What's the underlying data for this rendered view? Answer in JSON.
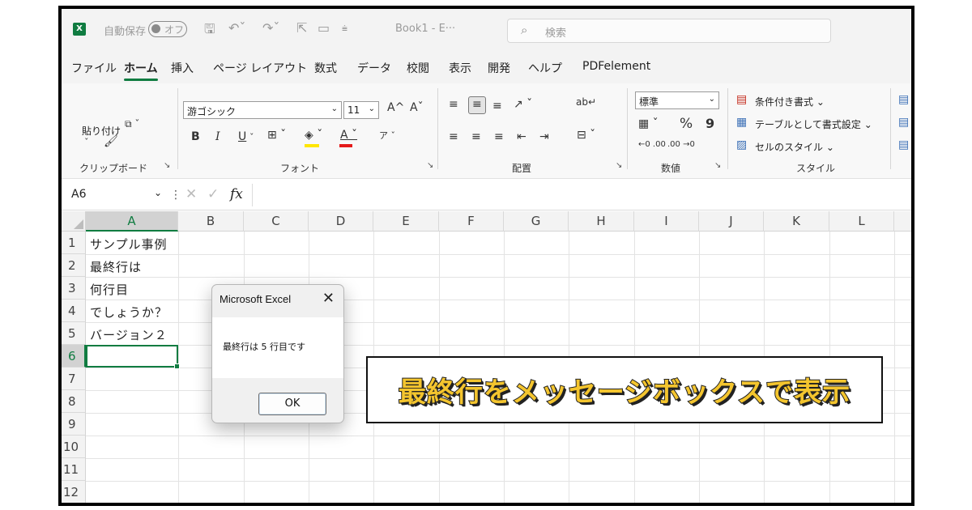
{
  "titlebar": {
    "autosave_label": "自動保存",
    "autosave_toggle": "オフ",
    "doc_title": "Book1 - E···",
    "search_placeholder": "検索"
  },
  "menu": {
    "items": [
      "ファイル",
      "ホーム",
      "挿入",
      "ページ レイアウト",
      "数式",
      "データ",
      "校閲",
      "表示",
      "開発",
      "ヘルプ",
      "PDFelement"
    ],
    "active": "ホーム"
  },
  "ribbon": {
    "clipboard": {
      "paste_label": "貼り付け",
      "group_label": "クリップボード"
    },
    "font": {
      "font_name": "游ゴシック",
      "font_size": "11",
      "bold": "B",
      "italic": "I",
      "underline": "U",
      "grow": "A^",
      "shrink": "Aˇ",
      "group_label": "フォント"
    },
    "alignment": {
      "group_label": "配置"
    },
    "number": {
      "format": "標準",
      "percent": "%",
      "comma": "9",
      "group_label": "数値"
    },
    "styles": {
      "conditional": "条件付き書式 ⌄",
      "as_table": "テーブルとして書式設定 ⌄",
      "cell_styles": "セルのスタイル ⌄",
      "group_label": "スタイル"
    }
  },
  "formula_bar": {
    "name_box": "A6",
    "fx": "fx",
    "formula": ""
  },
  "sheet": {
    "columns": [
      "A",
      "B",
      "C",
      "D",
      "E",
      "F",
      "G",
      "H",
      "I",
      "J",
      "K",
      "L"
    ],
    "selected_column": "A",
    "rows": [
      "1",
      "2",
      "3",
      "4",
      "5",
      "6",
      "7",
      "8",
      "9",
      "10",
      "11",
      "12"
    ],
    "selected_row": "6",
    "cells_A": [
      "サンプル事例",
      "最終行は",
      "何行目",
      "でしょうか？",
      "バージョン２"
    ]
  },
  "dialog": {
    "title": "Microsoft Excel",
    "message": "最終行は 5 行目です",
    "ok_label": "OK"
  },
  "banner": {
    "text": "最終行をメッセージボックスで表示"
  },
  "colors": {
    "excel_green": "#107c41",
    "banner_yellow": "#f4c52e"
  }
}
